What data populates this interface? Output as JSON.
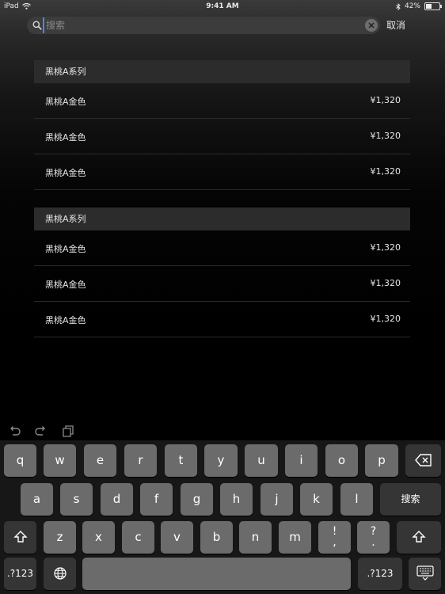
{
  "status_bar": {
    "device": "iPad",
    "time": "9:41 AM",
    "battery_percent": "42%",
    "battery_level": 0.42
  },
  "search": {
    "placeholder": "搜索",
    "value": "",
    "cancel_label": "取消"
  },
  "sections": [
    {
      "title": "黑桃A系列",
      "items": [
        {
          "name": "黑桃A金色",
          "price": "¥1,320"
        },
        {
          "name": "黑桃A金色",
          "price": "¥1,320"
        },
        {
          "name": "黑桃A金色",
          "price": "¥1,320"
        }
      ]
    },
    {
      "title": "黑桃A系列",
      "items": [
        {
          "name": "黑桃A金色",
          "price": "¥1,320"
        },
        {
          "name": "黑桃A金色",
          "price": "¥1,320"
        },
        {
          "name": "黑桃A金色",
          "price": "¥1,320"
        }
      ]
    }
  ],
  "keyboard": {
    "row1": [
      "q",
      "w",
      "e",
      "r",
      "t",
      "y",
      "u",
      "i",
      "o",
      "p"
    ],
    "row2": [
      "a",
      "s",
      "d",
      "f",
      "g",
      "h",
      "j",
      "k",
      "l"
    ],
    "row3": [
      "z",
      "x",
      "c",
      "v",
      "b",
      "n",
      "m"
    ],
    "punct1_top": "!",
    "punct1_bottom": ",",
    "punct2_top": "?",
    "punct2_bottom": ".",
    "search_key_label": "搜索",
    "numbers_key_label": ".?123"
  },
  "colors": {
    "accent_cursor": "#3d8eff",
    "key_light": "#6b6b6b",
    "key_dark": "#353535"
  }
}
